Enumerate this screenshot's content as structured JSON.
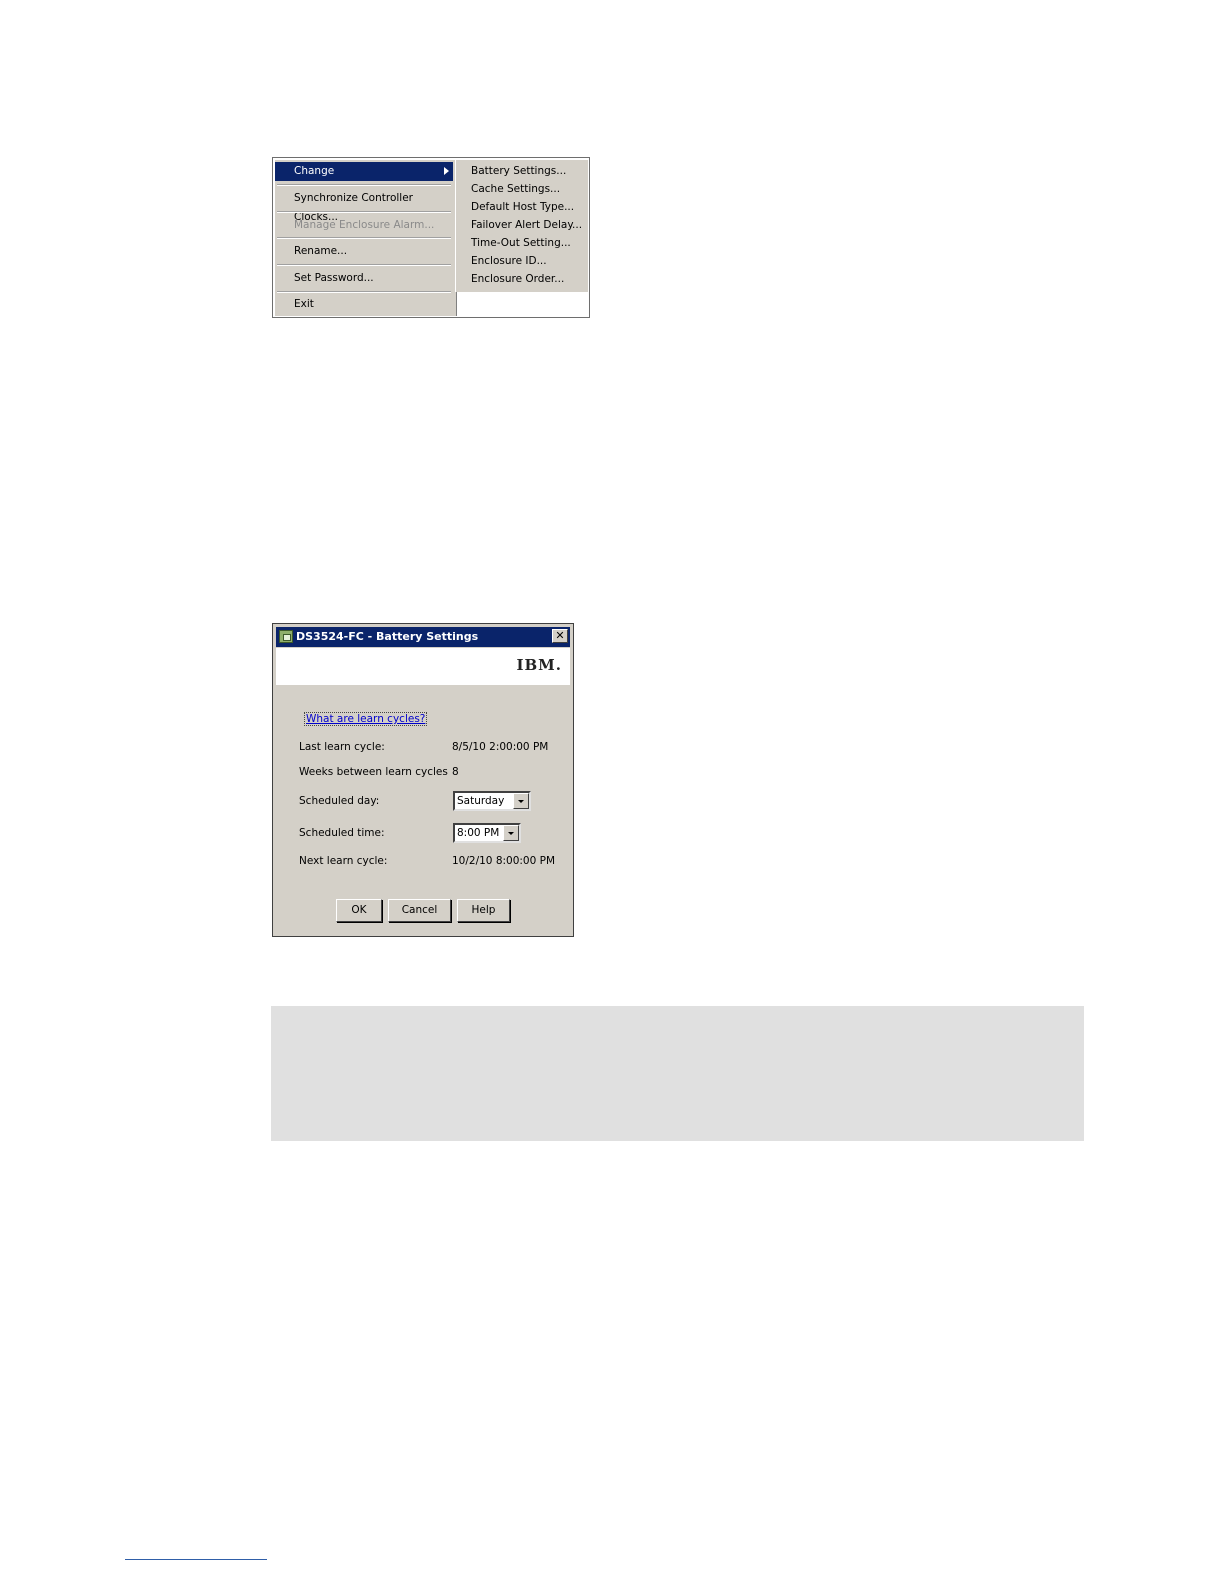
{
  "context_menu": {
    "items": [
      {
        "label": "Change",
        "state": "selected",
        "has_submenu": true
      },
      {
        "label": "Synchronize Controller Clocks...",
        "state": "enabled"
      },
      {
        "label": "Manage Enclosure Alarm...",
        "state": "disabled"
      },
      {
        "label": "Rename...",
        "state": "enabled"
      },
      {
        "label": "Set Password...",
        "state": "enabled"
      },
      {
        "label": "Exit",
        "state": "enabled"
      }
    ],
    "submenu": [
      "Battery Settings...",
      "Cache Settings...",
      "Default Host Type...",
      "Failover Alert Delay...",
      "Time-Out Setting...",
      "Enclosure ID...",
      "Enclosure Order..."
    ],
    "colors": {
      "menu_bg": "#d4d0c8",
      "highlight": "#0a246a"
    }
  },
  "battery_dialog": {
    "title": "DS3524-FC - Battery Settings",
    "logo": "IBM.",
    "link": "What are learn cycles?",
    "fields": {
      "last_learn_cycle": {
        "label": "Last learn cycle:",
        "value": "8/5/10 2:00:00 PM"
      },
      "weeks_between": {
        "label": "Weeks between learn cycles",
        "value": "8"
      },
      "scheduled_day": {
        "label": "Scheduled day:",
        "value": "Saturday"
      },
      "scheduled_time": {
        "label": "Scheduled time:",
        "value": "8:00 PM"
      },
      "next_learn_cycle": {
        "label": "Next learn cycle:",
        "value": "10/2/10 8:00:00 PM"
      }
    },
    "buttons": {
      "ok": "OK",
      "cancel": "Cancel",
      "help": "Help"
    },
    "colors": {
      "title_bar": "#0a246a",
      "dialog_bg": "#d4d0c8",
      "link": "#0000cc"
    }
  },
  "note_box": {
    "color": "#e0e0e0"
  }
}
